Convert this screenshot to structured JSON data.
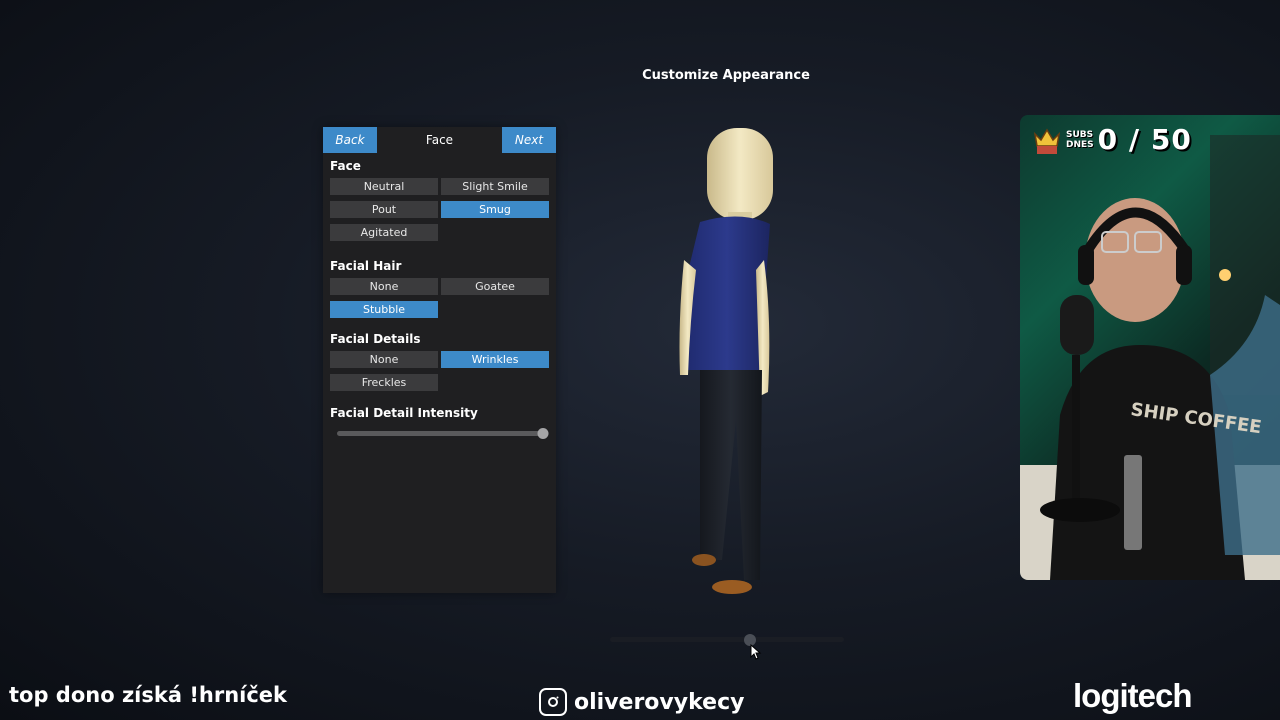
{
  "screen": {
    "title": "Customize Appearance"
  },
  "panel": {
    "back_label": "Back",
    "next_label": "Next",
    "title": "Face",
    "sections": {
      "face": {
        "label": "Face",
        "options": [
          "Neutral",
          "Slight Smile",
          "Pout",
          "Smug",
          "Agitated"
        ],
        "selected": "Smug"
      },
      "facial_hair": {
        "label": "Facial Hair",
        "options": [
          "None",
          "Goatee",
          "Stubble"
        ],
        "selected": "Stubble"
      },
      "facial_details": {
        "label": "Facial Details",
        "options": [
          "None",
          "Wrinkles",
          "Freckles"
        ],
        "selected": "Wrinkles"
      },
      "intensity": {
        "label": "Facial Detail Intensity",
        "value": 1.0
      }
    }
  },
  "rotation_slider": {
    "value": 0.6
  },
  "overlay": {
    "subs_label_line1": "SUBS",
    "subs_label_line2": "DNES",
    "subs_count": "0 / 50",
    "ticker": "top dono získá !hrníček",
    "social_handle": "oliverovykecy",
    "sponsor_logo": "logitech"
  },
  "colors": {
    "accent": "#3d8ac9",
    "panel_bg": "#1f1f21",
    "option_bg": "#3b3b3d"
  },
  "icons": {
    "social": "camera-icon",
    "cursor": "mouse-cursor-icon",
    "subs": "crown-icon"
  }
}
